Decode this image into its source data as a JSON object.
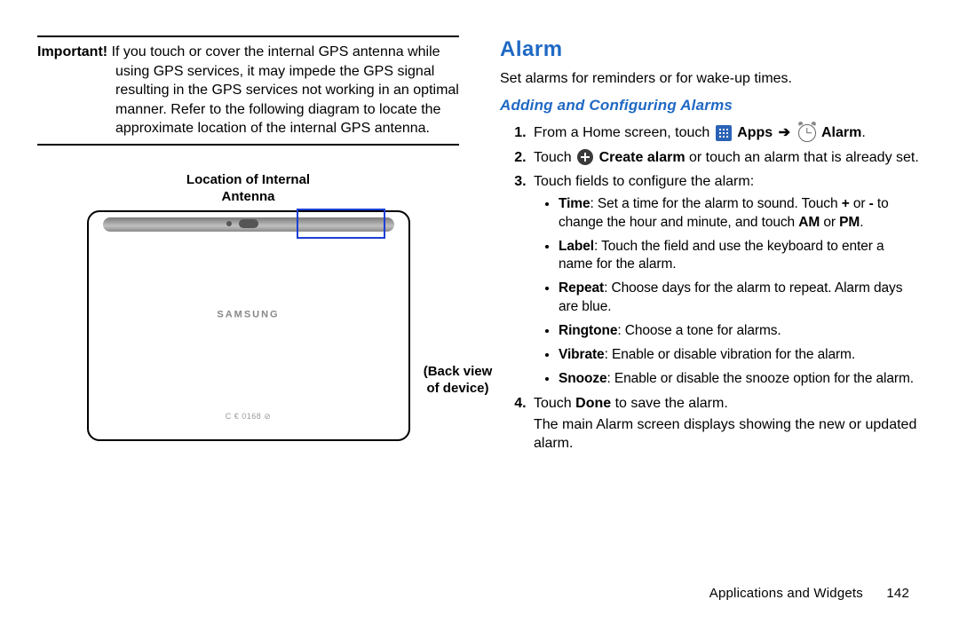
{
  "left": {
    "important_label": "Important!",
    "important_text": "If you touch or cover the internal GPS antenna while using GPS services, it may impede the GPS signal resulting in the GPS services not working in an optimal manner. Refer to the following diagram to locate the approximate location of the internal GPS antenna.",
    "diag_top_label_line1": "Location of Internal",
    "diag_top_label_line2": "Antenna",
    "brand": "SAMSUNG",
    "cemark": "C € 0168 ⊘",
    "back_label_line1": "(Back view",
    "back_label_line2": "of device)"
  },
  "right": {
    "alarm_heading": "Alarm",
    "alarm_lead": "Set alarms for reminders or for wake-up times.",
    "sub_heading": "Adding and Configuring Alarms",
    "step1_pre": "From a Home screen, touch ",
    "apps_label": "Apps",
    "arrow": "➔",
    "alarm_label": "Alarm",
    "step2_pre": "Touch ",
    "create_alarm": "Create alarm",
    "step2_post": " or touch an alarm that is already set.",
    "step3": "Touch fields to configure the alarm:",
    "bullets": {
      "time_b": "Time",
      "time_t": ": Set a time for the alarm to sound. Touch ",
      "time_plus": "+",
      "time_or": " or ",
      "time_minus": "-",
      "time_t2": " to change the hour and minute, and touch ",
      "time_am": "AM",
      "time_or2": " or ",
      "time_pm": "PM",
      "time_end": ".",
      "label_b": "Label",
      "label_t": ": Touch the field and use the keyboard to enter a name for the alarm.",
      "repeat_b": "Repeat",
      "repeat_t": ": Choose days for the alarm to repeat. Alarm days are blue.",
      "ringtone_b": "Ringtone",
      "ringtone_t": ": Choose a tone for alarms.",
      "vibrate_b": "Vibrate",
      "vibrate_t": ": Enable or disable vibration for the alarm.",
      "snooze_b": "Snooze",
      "snooze_t": ": Enable or disable the snooze option for the alarm."
    },
    "step4_pre": "Touch ",
    "done": "Done",
    "step4_post": " to save the alarm.",
    "step4_extra": "The main Alarm screen displays showing the new or updated alarm."
  },
  "footer": {
    "section": "Applications and Widgets",
    "page": "142"
  }
}
